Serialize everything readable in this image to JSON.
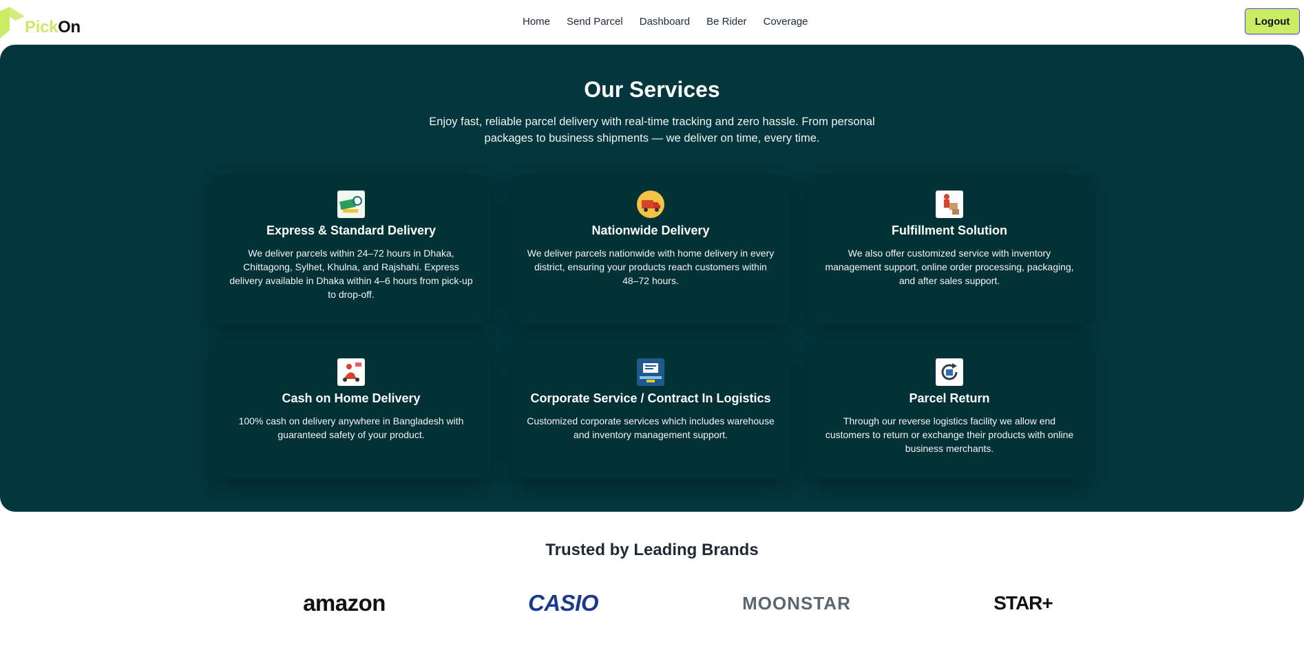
{
  "nav": {
    "logo_pick": "Pick",
    "logo_on": "On",
    "links": [
      "Home",
      "Send Parcel",
      "Dashboard",
      "Be Rider",
      "Coverage"
    ],
    "logout_label": "Logout"
  },
  "services": {
    "title": "Our Services",
    "intro": "Enjoy fast, reliable parcel delivery with real-time tracking and zero hassle. From personal packages to business shipments — we deliver on time, every time.",
    "cards": [
      {
        "title": "Express & Standard Delivery",
        "text": "We deliver parcels within 24–72 hours in Dhaka, Chittagong, Sylhet, Khulna, and Rajshahi. Express delivery available in Dhaka within 4–6 hours from pick-up to drop-off.",
        "icon": "express-delivery-icon"
      },
      {
        "title": "Nationwide Delivery",
        "text": "We deliver parcels nationwide with home delivery in every district, ensuring your products reach customers within 48–72 hours.",
        "icon": "delivery-truck-icon"
      },
      {
        "title": "Fulfillment Solution",
        "text": "We also offer customized service with inventory management support, online order processing, packaging, and after sales support.",
        "icon": "fulfillment-icon"
      },
      {
        "title": "Cash on Home Delivery",
        "text": "100% cash on delivery anywhere in Bangladesh with guaranteed safety of your product.",
        "icon": "cash-on-delivery-icon"
      },
      {
        "title": "Corporate Service / Contract In Logistics",
        "text": "Customized corporate services which includes warehouse and inventory management support.",
        "icon": "corporate-service-icon"
      },
      {
        "title": "Parcel Return",
        "text": "Through our reverse logistics facility we allow end customers to return or exchange their products with online business merchants.",
        "icon": "parcel-return-icon"
      }
    ]
  },
  "brands": {
    "title": "Trusted by Leading Brands",
    "items": [
      "amazon",
      "CASIO",
      "MOONSTAR",
      "STAR+"
    ]
  },
  "colors": {
    "accent": "#caeb66",
    "services_bg": "#03373d",
    "card_bg": "#023136",
    "text_dark": "#1f2937"
  }
}
